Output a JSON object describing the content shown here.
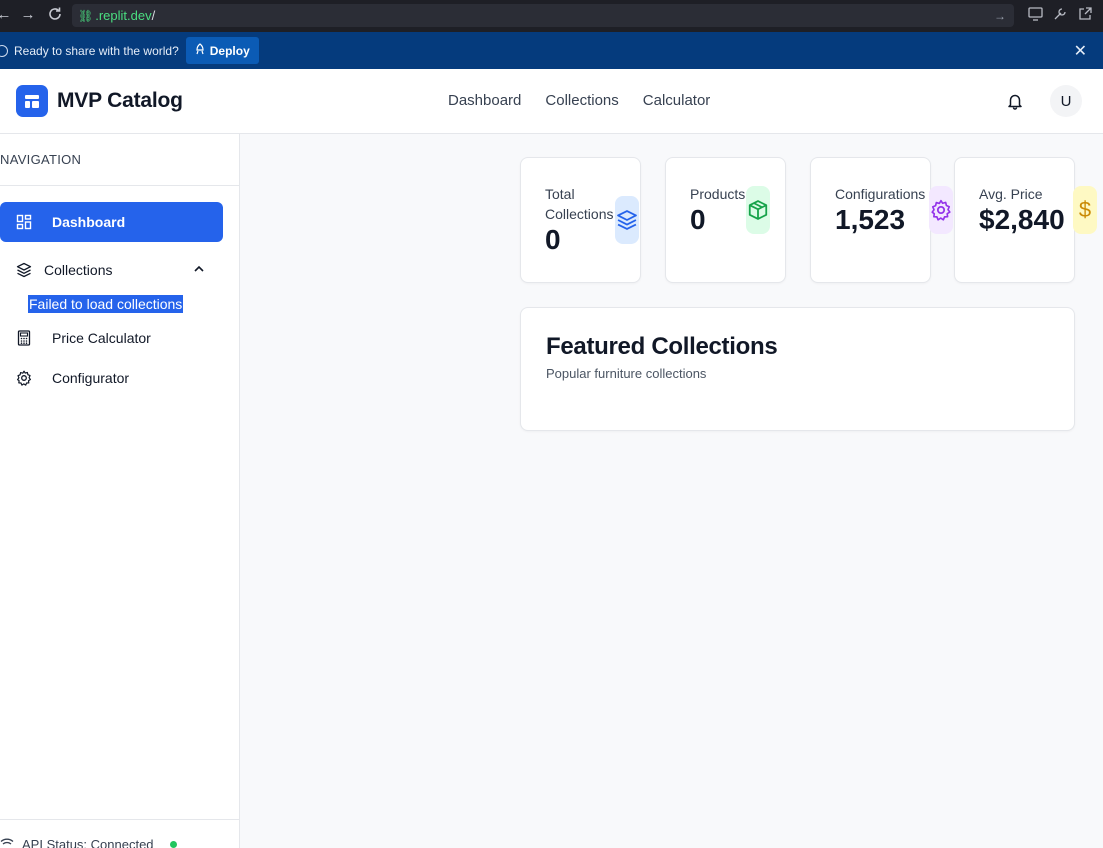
{
  "browser": {
    "url_host": ".replit.dev",
    "url_path": "/"
  },
  "banner": {
    "message": "Ready to share with the world?",
    "deploy_label": "Deploy"
  },
  "header": {
    "brand": "MVP Catalog",
    "nav": [
      "Dashboard",
      "Collections",
      "Calculator"
    ],
    "avatar_initial": "U"
  },
  "sidebar": {
    "title": "NAVIGATION",
    "items": [
      {
        "label": "Dashboard",
        "icon": "grid-icon",
        "active": true
      },
      {
        "label": "Collections",
        "icon": "layers-icon",
        "expanded": true
      },
      {
        "label": "Price Calculator",
        "icon": "calculator-icon"
      },
      {
        "label": "Configurator",
        "icon": "gear-icon"
      }
    ],
    "collections_error": "Failed to load collections",
    "api_status": "API Status: Connected"
  },
  "stats": [
    {
      "label": "Total Collections",
      "value": "0",
      "icon": "layers-icon",
      "color": "#2563eb",
      "bg": "#dbeafe"
    },
    {
      "label": "Products",
      "value": "0",
      "icon": "package-icon",
      "color": "#16a34a",
      "bg": "#dcfce7"
    },
    {
      "label": "Configurations",
      "value": "1,523",
      "icon": "gear-icon",
      "color": "#9333ea",
      "bg": "#f3e8ff"
    },
    {
      "label": "Avg. Price",
      "value": "$2,840",
      "icon": "dollar-icon",
      "color": "#ca8a04",
      "bg": "#fef9c3"
    }
  ],
  "featured": {
    "title": "Featured Collections",
    "subtitle": "Popular furniture collections"
  },
  "colors": {
    "primary": "#2563eb",
    "banner": "#053b7d",
    "status_ok": "#22c55e"
  }
}
